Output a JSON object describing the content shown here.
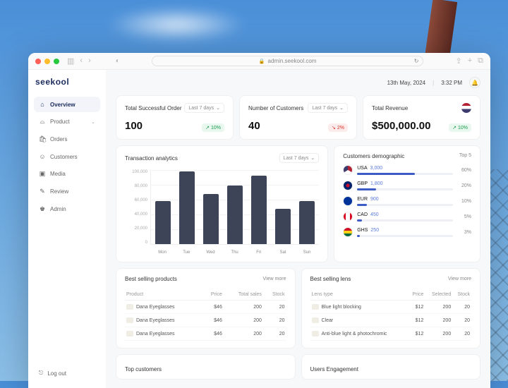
{
  "browser": {
    "url": "admin.seekool.com"
  },
  "brand": "seekool",
  "header": {
    "date": "13th May, 2024",
    "time": "3:32 PM"
  },
  "sidebar": {
    "items": [
      {
        "label": "Overview",
        "icon": "⌂"
      },
      {
        "label": "Product",
        "icon": "⌓",
        "expandable": true
      },
      {
        "label": "Orders",
        "icon": "🛍"
      },
      {
        "label": "Customers",
        "icon": "☺"
      },
      {
        "label": "Media",
        "icon": "▣"
      },
      {
        "label": "Review",
        "icon": "✎"
      },
      {
        "label": "Admin",
        "icon": "♚"
      }
    ],
    "logout": "Log out"
  },
  "kpis": {
    "orders": {
      "title": "Total Successful Order",
      "period": "Last 7 days",
      "value": "100",
      "trend": "10%",
      "dir": "up"
    },
    "customers": {
      "title": "Number of Customers",
      "period": "Last 7 days",
      "value": "40",
      "trend": "2%",
      "dir": "down"
    },
    "revenue": {
      "title": "Total Revenue",
      "value": "$500,000.00",
      "trend": "10%",
      "dir": "up"
    }
  },
  "analytics": {
    "title": "Transaction analytics",
    "period": "Last 7 days",
    "ylabels": [
      "100,000",
      "80,000",
      "60,000",
      "40,000",
      "20,000",
      "0"
    ]
  },
  "chart_data": {
    "type": "bar",
    "title": "Transaction analytics",
    "categories": [
      "Mon",
      "Tue",
      "Wed",
      "Thu",
      "Fri",
      "Sat",
      "Sun"
    ],
    "values": [
      58000,
      98000,
      68000,
      79000,
      92000,
      48000,
      58000
    ],
    "ylabel": "",
    "ylim": [
      0,
      100000
    ]
  },
  "demographics": {
    "title": "Customers demographic",
    "subtitle": "Top 5",
    "rows": [
      {
        "code": "USA",
        "value": "3,000",
        "pct": 60
      },
      {
        "code": "GBP",
        "value": "1,800",
        "pct": 20
      },
      {
        "code": "EUR",
        "value": "900",
        "pct": 10
      },
      {
        "code": "CAD",
        "value": "450",
        "pct": 5
      },
      {
        "code": "GHS",
        "value": "250",
        "pct": 3
      }
    ]
  },
  "bestProducts": {
    "title": "Best selling products",
    "more": "View more",
    "headers": [
      "Product",
      "Price",
      "Total sales",
      "Stock"
    ],
    "rows": [
      {
        "name": "Dana Eyeglasses",
        "price": "$46",
        "sales": "200",
        "stock": "20"
      },
      {
        "name": "Dana Eyeglasses",
        "price": "$46",
        "sales": "200",
        "stock": "20"
      },
      {
        "name": "Dana Eyeglasses",
        "price": "$46",
        "sales": "200",
        "stock": "20"
      }
    ]
  },
  "bestLens": {
    "title": "Best selling lens",
    "more": "View more",
    "headers": [
      "Lens type",
      "Price",
      "Selected",
      "Stock"
    ],
    "rows": [
      {
        "name": "Blue light blocking",
        "price": "$12",
        "selected": "200",
        "stock": "20"
      },
      {
        "name": "Clear",
        "price": "$12",
        "selected": "200",
        "stock": "20"
      },
      {
        "name": "Anti-blue light & photochromic",
        "price": "$12",
        "selected": "200",
        "stock": "20"
      }
    ]
  },
  "bottom": {
    "topCustomers": "Top customers",
    "engagement": "Users Engagement"
  }
}
